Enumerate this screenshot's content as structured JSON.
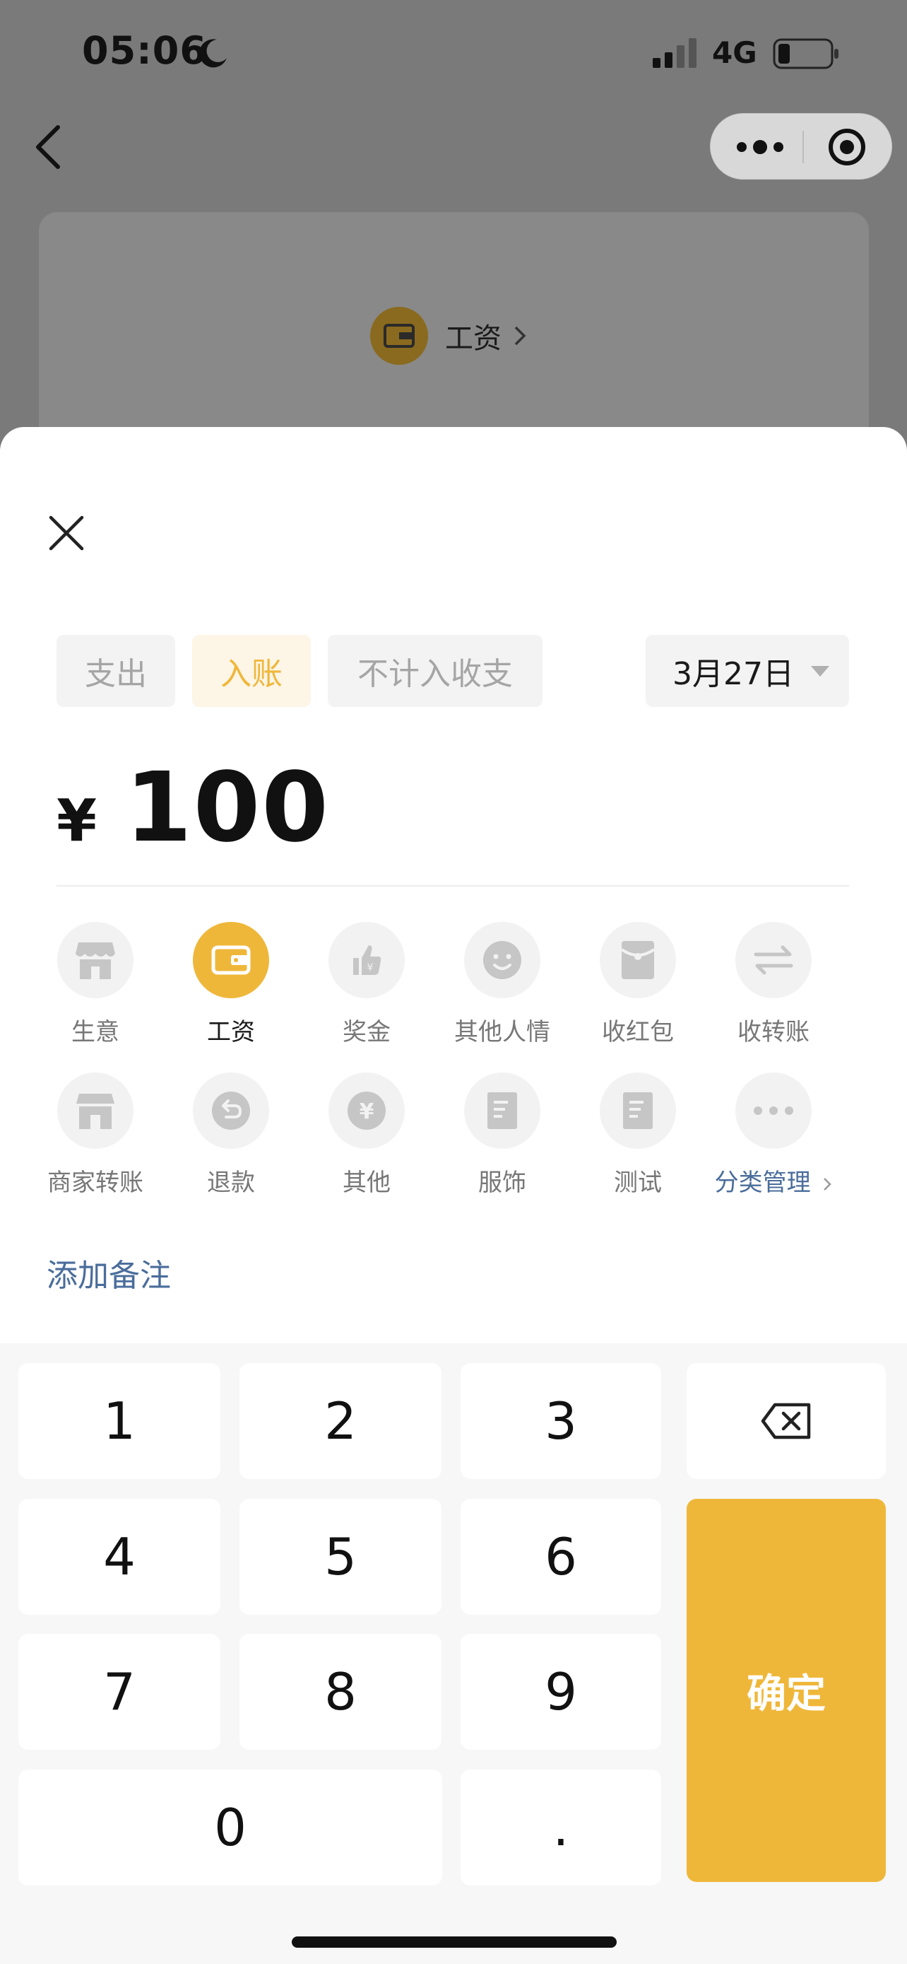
{
  "status_bar": {
    "time": "05:06",
    "network": "4G"
  },
  "background_page": {
    "category_label": "工资"
  },
  "sheet": {
    "type_tabs": [
      {
        "label": "支出",
        "active": false
      },
      {
        "label": "入账",
        "active": true
      },
      {
        "label": "不计入收支",
        "active": false
      }
    ],
    "date": "3月27日",
    "amount": {
      "currency": "¥",
      "value": "100"
    },
    "categories": [
      {
        "label": "生意",
        "icon": "shop-icon",
        "active": false
      },
      {
        "label": "工资",
        "icon": "wallet-icon",
        "active": true
      },
      {
        "label": "奖金",
        "icon": "thumb-up-icon",
        "active": false
      },
      {
        "label": "其他人情",
        "icon": "smile-icon",
        "active": false
      },
      {
        "label": "收红包",
        "icon": "red-envelope-icon",
        "active": false
      },
      {
        "label": "收转账",
        "icon": "transfer-icon",
        "active": false
      },
      {
        "label": "商家转账",
        "icon": "store-icon",
        "active": false
      },
      {
        "label": "退款",
        "icon": "refund-icon",
        "active": false
      },
      {
        "label": "其他",
        "icon": "yen-icon",
        "active": false
      },
      {
        "label": "服饰",
        "icon": "document-icon",
        "active": false
      },
      {
        "label": "测试",
        "icon": "document-icon",
        "active": false
      },
      {
        "label": "分类管理",
        "icon": "more-icon",
        "active": false
      }
    ],
    "remark_link": "添加备注"
  },
  "keypad": {
    "keys": [
      "1",
      "2",
      "3",
      "4",
      "5",
      "6",
      "7",
      "8",
      "9",
      "0",
      "."
    ],
    "confirm_label": "确定"
  },
  "colors": {
    "accent": "#efb73a",
    "link": "#4a6d9b",
    "inactive_text": "#a5a5a5"
  }
}
